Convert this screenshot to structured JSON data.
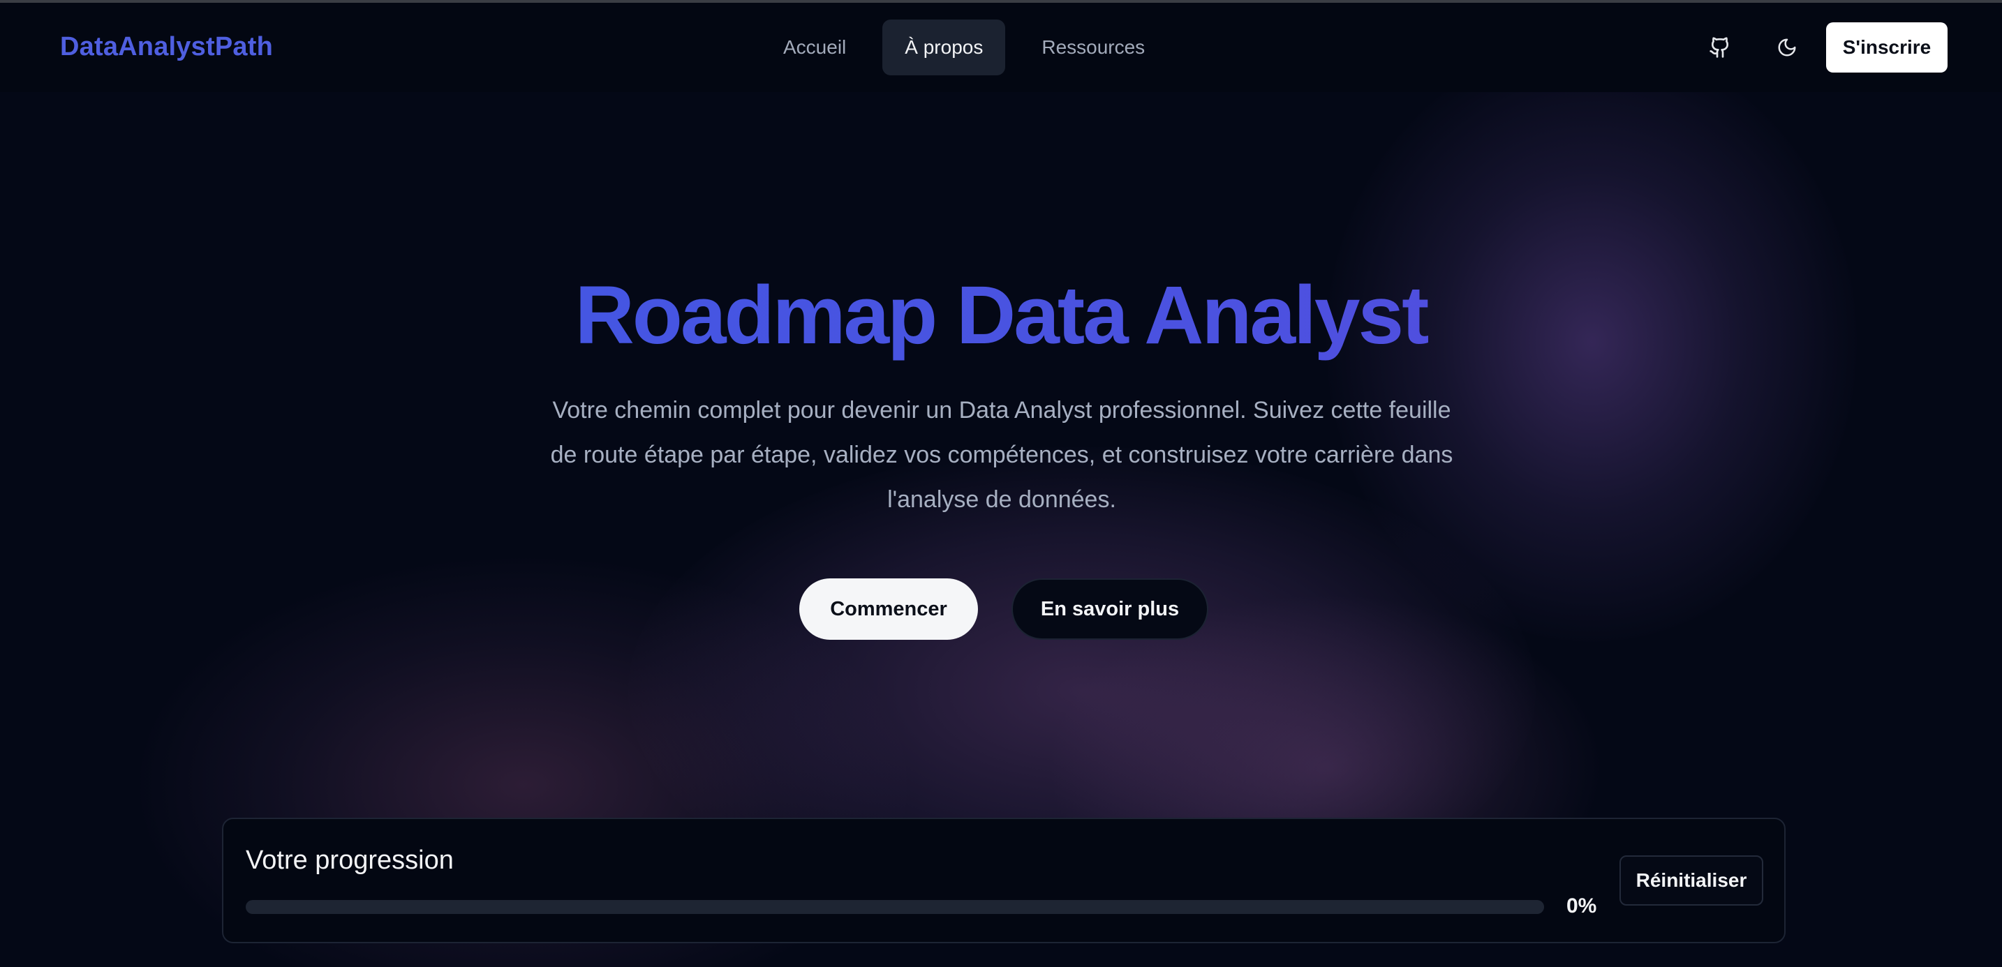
{
  "brand": {
    "name": "DataAnalystPath",
    "color": "#4f5fe0"
  },
  "nav": {
    "items": [
      {
        "label": "Accueil",
        "active": false
      },
      {
        "label": "À propos",
        "active": true
      },
      {
        "label": "Ressources",
        "active": false
      }
    ]
  },
  "header_actions": {
    "github_icon": "github-icon",
    "theme_icon": "moon-icon",
    "signup_label": "S'inscrire"
  },
  "hero": {
    "title": "Roadmap Data Analyst",
    "subtitle": "Votre chemin complet pour devenir un Data Analyst professionnel. Suivez cette feuille de route étape par étape, validez vos compétences, et construisez votre carrière dans l'analyse de données.",
    "primary_cta": "Commencer",
    "secondary_cta": "En savoir plus"
  },
  "progress": {
    "title": "Votre progression",
    "value": 0,
    "percent_label": "0%",
    "reset_label": "Réinitialiser"
  },
  "colors": {
    "background": "#040816",
    "accent": "#4f5fe0",
    "title_gradient_start": "#3f59e4",
    "title_gradient_end": "#5a48dc"
  }
}
